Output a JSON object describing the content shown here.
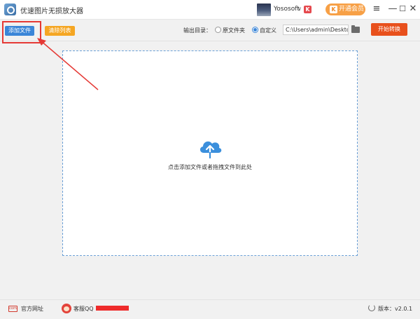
{
  "window": {
    "title": "优速图片无损放大器",
    "username": "Yososoft",
    "user_caret": "∨",
    "brand_badge": "K",
    "vip_icon": "K",
    "vip_label": "开通会员",
    "menu_glyph": "≡",
    "minimize_glyph": "—",
    "maximize_glyph": "☐",
    "close_glyph": "✕"
  },
  "toolbar": {
    "add_file_label": "添加文件",
    "clear_list_label": "清除列表",
    "output_dir_label": "输出目录：",
    "radio_original_label": "原文件夹",
    "radio_custom_label": "自定义",
    "selected_output": "自定义",
    "path_value": "C:\\Users\\admin\\Deskto",
    "start_label": "开始转换"
  },
  "dropzone": {
    "hint": "点击添加文件或者拖拽文件到此处",
    "icon": "cloud-upload-icon"
  },
  "footer": {
    "website_label": "官方网址",
    "website_icon_text": "com",
    "support_label": "客服QQ",
    "version_label": "版本：v2.0.1"
  },
  "colors": {
    "primary": "#3b86d8",
    "clear": "#f5a623",
    "start": "#e8501c",
    "vip": "#f7a046",
    "annotation": "#e53935"
  }
}
